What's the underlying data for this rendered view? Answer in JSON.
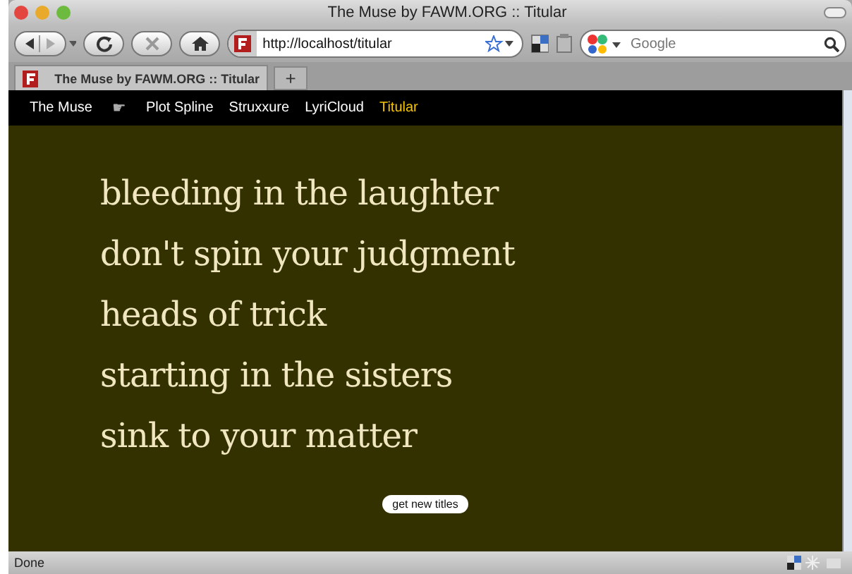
{
  "window": {
    "title": "The Muse by FAWM.ORG :: Titular"
  },
  "toolbar": {
    "url": "http://localhost/titular",
    "search": {
      "placeholder": "Google"
    }
  },
  "tabs": [
    {
      "label": "The Muse by FAWM.ORG :: Titular",
      "selected": true
    }
  ],
  "new_tab": "+",
  "nav": [
    {
      "label": "The Muse",
      "kind": "link",
      "selected": false
    },
    {
      "label": "☛",
      "kind": "separator"
    },
    {
      "label": "Plot Spline",
      "kind": "link",
      "selected": false
    },
    {
      "label": "Struxxure",
      "kind": "link",
      "selected": false
    },
    {
      "label": "LyriCloud",
      "kind": "link",
      "selected": false
    },
    {
      "label": "Titular",
      "kind": "link",
      "selected": true
    }
  ],
  "titles": [
    "bleeding in the laughter",
    "don't spin your judgment",
    "heads of trick",
    "starting in the sisters",
    "sink to your matter"
  ],
  "button": "get new titles",
  "status_bar": "Done"
}
